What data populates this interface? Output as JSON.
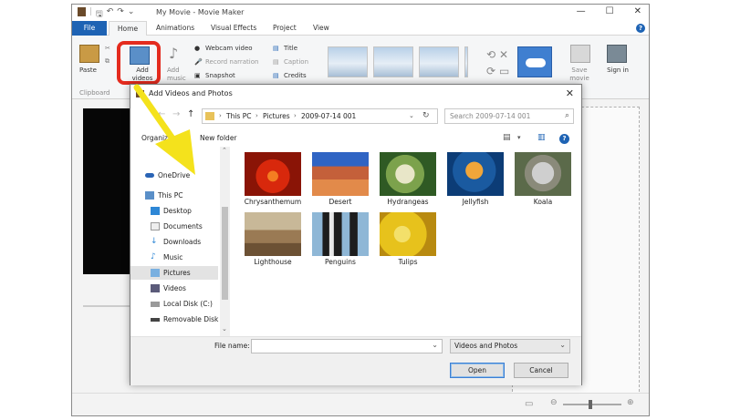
{
  "app": {
    "title": "My Movie - Movie Maker",
    "window_controls": [
      "—",
      "☐",
      "✕"
    ]
  },
  "tabs": [
    "File",
    "Home",
    "Animations",
    "Visual Effects",
    "Project",
    "View"
  ],
  "ribbon": {
    "paste": "Paste",
    "clipboard_group": "Clipboard",
    "add_videos_photos": "Add videos and photos",
    "add_music": "Add music",
    "webcam_video": "Webcam video",
    "record_narration": "Record narration",
    "snapshot": "Snapshot",
    "title": "Title",
    "caption": "Caption",
    "credits": "Credits",
    "save_movie": "Save movie",
    "sign_in": "Sign in"
  },
  "dialog": {
    "title": "Add Videos and Photos",
    "breadcrumb": [
      "This PC",
      "Pictures",
      "2009-07-14 001"
    ],
    "search_placeholder": "Search 2009-07-14 001",
    "organize": "Organize",
    "new_folder": "New folder",
    "nav_items": [
      {
        "label": "OneDrive",
        "icon": "cloud-icon"
      },
      {
        "label": "This PC",
        "icon": "computer-icon"
      },
      {
        "label": "Desktop",
        "icon": "desktop-icon"
      },
      {
        "label": "Documents",
        "icon": "documents-icon"
      },
      {
        "label": "Downloads",
        "icon": "download-icon"
      },
      {
        "label": "Music",
        "icon": "music-icon"
      },
      {
        "label": "Pictures",
        "icon": "pictures-icon"
      },
      {
        "label": "Videos",
        "icon": "videos-icon"
      },
      {
        "label": "Local Disk (C:)",
        "icon": "disk-icon"
      },
      {
        "label": "Removable Disk",
        "icon": "removable-disk-icon"
      }
    ],
    "files": [
      {
        "name": "Chrysanthemum",
        "colors": [
          "#d8280c",
          "#f47e22"
        ]
      },
      {
        "name": "Desert",
        "colors": [
          "#e28a4a",
          "#3c6fc2"
        ]
      },
      {
        "name": "Hydrangeas",
        "colors": [
          "#2f5a24",
          "#e8e6c8"
        ]
      },
      {
        "name": "Jellyfish",
        "colors": [
          "#0c3c76",
          "#f0a63a"
        ]
      },
      {
        "name": "Koala",
        "colors": [
          "#5b6a4a",
          "#cfcfcf"
        ]
      },
      {
        "name": "Lighthouse",
        "colors": [
          "#6c5134",
          "#c8b898"
        ]
      },
      {
        "name": "Penguins",
        "colors": [
          "#8fb7d6",
          "#1d1d1d"
        ]
      },
      {
        "name": "Tulips",
        "colors": [
          "#e7c21c",
          "#f3e06a"
        ]
      }
    ],
    "file_name_label": "File name:",
    "file_name_value": "",
    "file_type": "Videos and Photos",
    "open": "Open",
    "cancel": "Cancel"
  },
  "colors": {
    "accent": "#1e63b4",
    "highlight_box": "#e42b1e",
    "arrow": "#f4e21c"
  }
}
